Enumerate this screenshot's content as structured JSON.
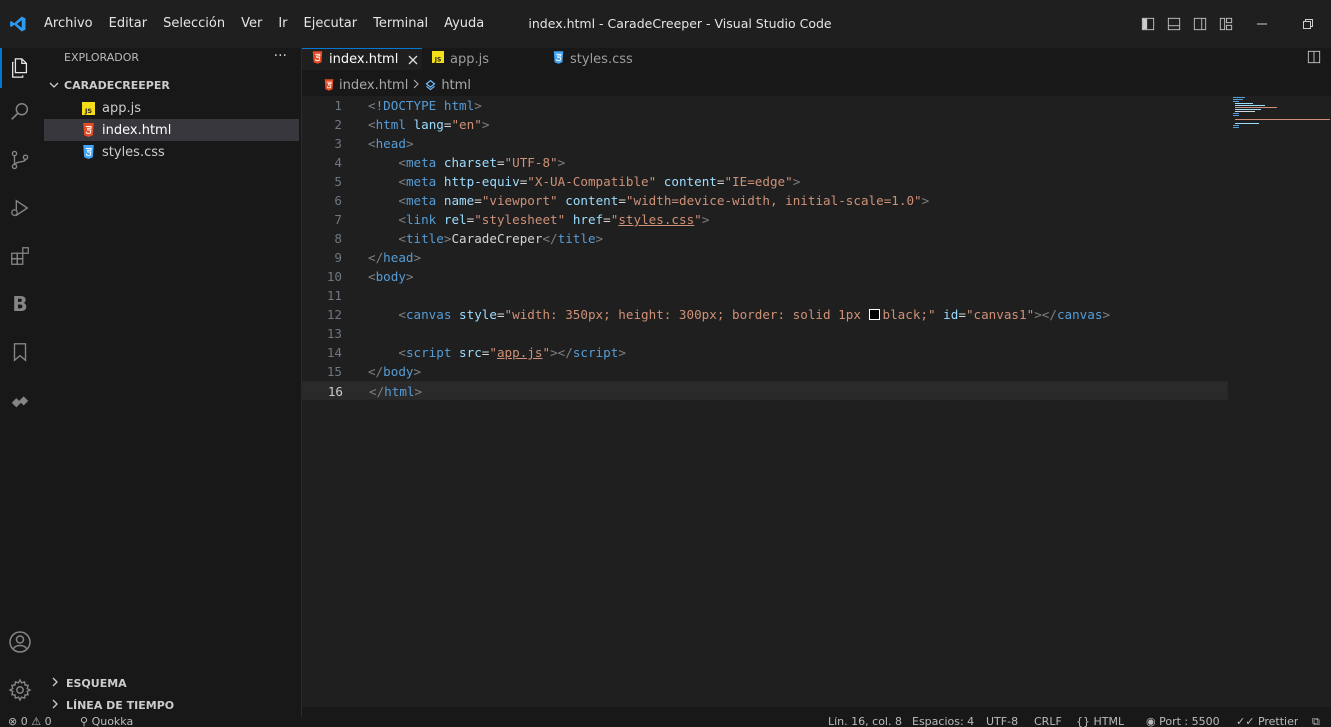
{
  "titlebar": {
    "menu": [
      "Archivo",
      "Editar",
      "Selección",
      "Ver",
      "Ir",
      "Ejecutar",
      "Terminal",
      "Ayuda"
    ],
    "window_title": "index.html - CaradeCreeper - Visual Studio Code"
  },
  "activity_bar": {
    "items": [
      "explorer-icon",
      "search-icon",
      "source-control-icon",
      "run-debug-icon",
      "extensions-icon",
      "b-extension-icon",
      "bookmark-icon",
      "live-share-icon"
    ],
    "b_label": "B",
    "bottom": [
      "account-icon",
      "settings-gear-icon"
    ]
  },
  "sidebar": {
    "header": "EXPLORADOR",
    "more": "···",
    "folder": "CARADECREEPER",
    "files": [
      {
        "name": "app.js",
        "type": "js"
      },
      {
        "name": "index.html",
        "type": "html",
        "selected": true
      },
      {
        "name": "styles.css",
        "type": "css"
      }
    ],
    "panels": [
      "ESQUEMA",
      "LÍNEA DE TIEMPO"
    ]
  },
  "tabs": [
    {
      "label": "index.html",
      "type": "html",
      "active": true
    },
    {
      "label": "app.js",
      "type": "js",
      "active": false
    },
    {
      "label": "styles.css",
      "type": "css",
      "active": false
    }
  ],
  "breadcrumb": {
    "file": "index.html",
    "symbol": "html"
  },
  "editor": {
    "current_line": 16,
    "lines": [
      {
        "n": "1",
        "tokens": [
          [
            "b",
            "<"
          ],
          [
            "t",
            "!DOCTYPE"
          ],
          [
            "x",
            " "
          ],
          [
            "t",
            "html"
          ],
          [
            "b",
            ">"
          ]
        ]
      },
      {
        "n": "2",
        "tokens": [
          [
            "b",
            "<"
          ],
          [
            "t",
            "html"
          ],
          [
            "x",
            " "
          ],
          [
            "a",
            "lang"
          ],
          [
            "p",
            "="
          ],
          [
            "s",
            "\"en\""
          ],
          [
            "b",
            ">"
          ]
        ]
      },
      {
        "n": "3",
        "tokens": [
          [
            "b",
            "<"
          ],
          [
            "t",
            "head"
          ],
          [
            "b",
            ">"
          ]
        ]
      },
      {
        "n": "4",
        "tokens": [
          [
            "x",
            "    "
          ],
          [
            "b",
            "<"
          ],
          [
            "t",
            "meta"
          ],
          [
            "x",
            " "
          ],
          [
            "a",
            "charset"
          ],
          [
            "p",
            "="
          ],
          [
            "s",
            "\"UTF-8\""
          ],
          [
            "b",
            ">"
          ]
        ]
      },
      {
        "n": "5",
        "tokens": [
          [
            "x",
            "    "
          ],
          [
            "b",
            "<"
          ],
          [
            "t",
            "meta"
          ],
          [
            "x",
            " "
          ],
          [
            "a",
            "http-equiv"
          ],
          [
            "p",
            "="
          ],
          [
            "s",
            "\"X-UA-Compatible\""
          ],
          [
            "x",
            " "
          ],
          [
            "a",
            "content"
          ],
          [
            "p",
            "="
          ],
          [
            "s",
            "\"IE=edge\""
          ],
          [
            "b",
            ">"
          ]
        ]
      },
      {
        "n": "6",
        "tokens": [
          [
            "x",
            "    "
          ],
          [
            "b",
            "<"
          ],
          [
            "t",
            "meta"
          ],
          [
            "x",
            " "
          ],
          [
            "a",
            "name"
          ],
          [
            "p",
            "="
          ],
          [
            "s",
            "\"viewport\""
          ],
          [
            "x",
            " "
          ],
          [
            "a",
            "content"
          ],
          [
            "p",
            "="
          ],
          [
            "s",
            "\"width=device-width, initial-scale=1.0\""
          ],
          [
            "b",
            ">"
          ]
        ]
      },
      {
        "n": "7",
        "tokens": [
          [
            "x",
            "    "
          ],
          [
            "b",
            "<"
          ],
          [
            "t",
            "link"
          ],
          [
            "x",
            " "
          ],
          [
            "a",
            "rel"
          ],
          [
            "p",
            "="
          ],
          [
            "s",
            "\"stylesheet\""
          ],
          [
            "x",
            " "
          ],
          [
            "a",
            "href"
          ],
          [
            "p",
            "="
          ],
          [
            "s",
            "\""
          ],
          [
            "l",
            "styles.css"
          ],
          [
            "s",
            "\""
          ],
          [
            "b",
            ">"
          ]
        ]
      },
      {
        "n": "8",
        "tokens": [
          [
            "x",
            "    "
          ],
          [
            "b",
            "<"
          ],
          [
            "t",
            "title"
          ],
          [
            "b",
            ">"
          ],
          [
            "x",
            "CaradeCreper"
          ],
          [
            "b",
            "</"
          ],
          [
            "t",
            "title"
          ],
          [
            "b",
            ">"
          ]
        ]
      },
      {
        "n": "9",
        "tokens": [
          [
            "b",
            "</"
          ],
          [
            "t",
            "head"
          ],
          [
            "b",
            ">"
          ]
        ]
      },
      {
        "n": "10",
        "tokens": [
          [
            "b",
            "<"
          ],
          [
            "t",
            "body"
          ],
          [
            "b",
            ">"
          ]
        ]
      },
      {
        "n": "11",
        "tokens": []
      },
      {
        "n": "12",
        "tokens": [
          [
            "x",
            "    "
          ],
          [
            "b",
            "<"
          ],
          [
            "t",
            "canvas"
          ],
          [
            "x",
            " "
          ],
          [
            "a",
            "style"
          ],
          [
            "p",
            "="
          ],
          [
            "s",
            "\"width: 350px; height: 300px; border: solid 1px "
          ],
          [
            "c",
            ""
          ],
          [
            "s",
            "black;\""
          ],
          [
            "x",
            " "
          ],
          [
            "a",
            "id"
          ],
          [
            "p",
            "="
          ],
          [
            "s",
            "\"canvas1\""
          ],
          [
            "b",
            "></"
          ],
          [
            "t",
            "canvas"
          ],
          [
            "b",
            ">"
          ]
        ]
      },
      {
        "n": "13",
        "tokens": []
      },
      {
        "n": "14",
        "tokens": [
          [
            "x",
            "    "
          ],
          [
            "b",
            "<"
          ],
          [
            "t",
            "script"
          ],
          [
            "x",
            " "
          ],
          [
            "a",
            "src"
          ],
          [
            "p",
            "="
          ],
          [
            "s",
            "\""
          ],
          [
            "l",
            "app.js"
          ],
          [
            "s",
            "\""
          ],
          [
            "b",
            "></"
          ],
          [
            "t",
            "script"
          ],
          [
            "b",
            ">"
          ]
        ]
      },
      {
        "n": "15",
        "tokens": [
          [
            "b",
            "</"
          ],
          [
            "t",
            "body"
          ],
          [
            "b",
            ">"
          ]
        ]
      },
      {
        "n": "16",
        "tokens": [
          [
            "b",
            "</"
          ],
          [
            "t",
            "html"
          ],
          [
            "b",
            ">"
          ]
        ]
      }
    ]
  },
  "statusbar": {
    "errors": "0",
    "warnings": "0",
    "quokka": "Quokka",
    "position": "Lín. 16, col. 8",
    "spaces": "Espacios: 4",
    "encoding": "UTF-8",
    "eol": "CRLF",
    "language": "HTML",
    "port": "Port : 5500",
    "prettier": "Prettier"
  },
  "colors": {
    "accent": "#0078d4",
    "html_icon": "#e44d26",
    "js_icon": "#f5de19",
    "css_icon": "#42a5f5"
  }
}
